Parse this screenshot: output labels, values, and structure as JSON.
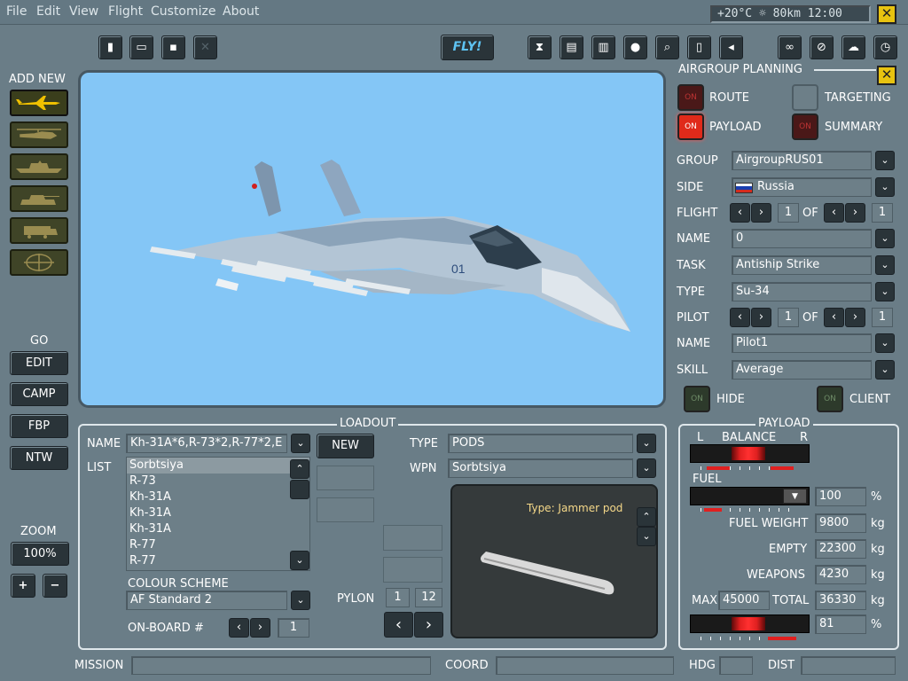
{
  "menu": [
    "File",
    "Edit",
    "View",
    "Flight",
    "Customize",
    "About"
  ],
  "weather": "+20°C ☼ 80km 12:00",
  "toolbar": {
    "fly_label": "FLY!"
  },
  "add_new": {
    "title": "ADD NEW",
    "items": [
      "airplane-icon",
      "helicopter-icon",
      "ship-icon",
      "tank-icon",
      "vehicle-icon",
      "static-target-icon"
    ]
  },
  "go": {
    "title": "GO",
    "buttons": [
      "EDIT",
      "CAMP",
      "FBP",
      "NTW"
    ]
  },
  "zoom": {
    "title": "ZOOM",
    "value": "100%",
    "plus": "+",
    "minus": "−"
  },
  "airgroup": {
    "title": "AIRGROUP PLANNING",
    "route": "ROUTE",
    "targeting": "TARGETING",
    "payload": "PAYLOAD",
    "summary": "SUMMARY",
    "on": "ON",
    "group_label": "GROUP",
    "group": "AirgroupRUS01",
    "side_label": "SIDE",
    "side": "Russia",
    "flight_label": "FLIGHT",
    "flight_num": "1",
    "of": "OF",
    "flight_total": "1",
    "name_label": "NAME",
    "name": "0",
    "task_label": "TASK",
    "task": "Antiship Strike",
    "type_label": "TYPE",
    "type": "Su-34",
    "pilot_label": "PILOT",
    "pilot_num": "1",
    "pilot_total": "1",
    "pname_label": "NAME",
    "pname": "Pilot1",
    "skill_label": "SKILL",
    "skill": "Average",
    "hide": "HIDE",
    "client": "CLIENT"
  },
  "loadout": {
    "title": "LOADOUT",
    "name_label": "NAME",
    "name": "Kh-31A*6,R-73*2,R-77*2,E",
    "new": "NEW",
    "list_label": "LIST",
    "list": [
      "Sorbtsiya",
      "R-73",
      "Kh-31A",
      "Kh-31A",
      "Kh-31A",
      "R-77",
      "R-77"
    ],
    "colour_label": "COLOUR SCHEME",
    "colour": "AF Standard 2",
    "onboard_label": "ON-BOARD #",
    "onboard": "1",
    "type_label": "TYPE",
    "type": "PODS",
    "wpn_label": "WPN",
    "wpn": "Sorbtsiya",
    "pylon_label": "PYLON",
    "pylon_num": "1",
    "pylon_total": "12",
    "wpn_type": "Type: Jammer pod"
  },
  "payload": {
    "title": "PAYLOAD",
    "balance_l": "L",
    "balance": "BALANCE",
    "balance_r": "R",
    "fuel_label": "FUEL",
    "fuel": "100",
    "pct": "%",
    "fuel_weight_label": "FUEL WEIGHT",
    "fuel_weight": "9800",
    "empty_label": "EMPTY",
    "empty": "22300",
    "weapons_label": "WEAPONS",
    "weapons": "4230",
    "max_label": "MAX",
    "max": "45000",
    "total_label": "TOTAL",
    "total": "36330",
    "load_pct": "81",
    "kg": "kg"
  },
  "status": {
    "mission": "MISSION",
    "coord": "COORD",
    "hdg": "HDG",
    "dist": "DIST"
  },
  "aircraft_marking": "01"
}
